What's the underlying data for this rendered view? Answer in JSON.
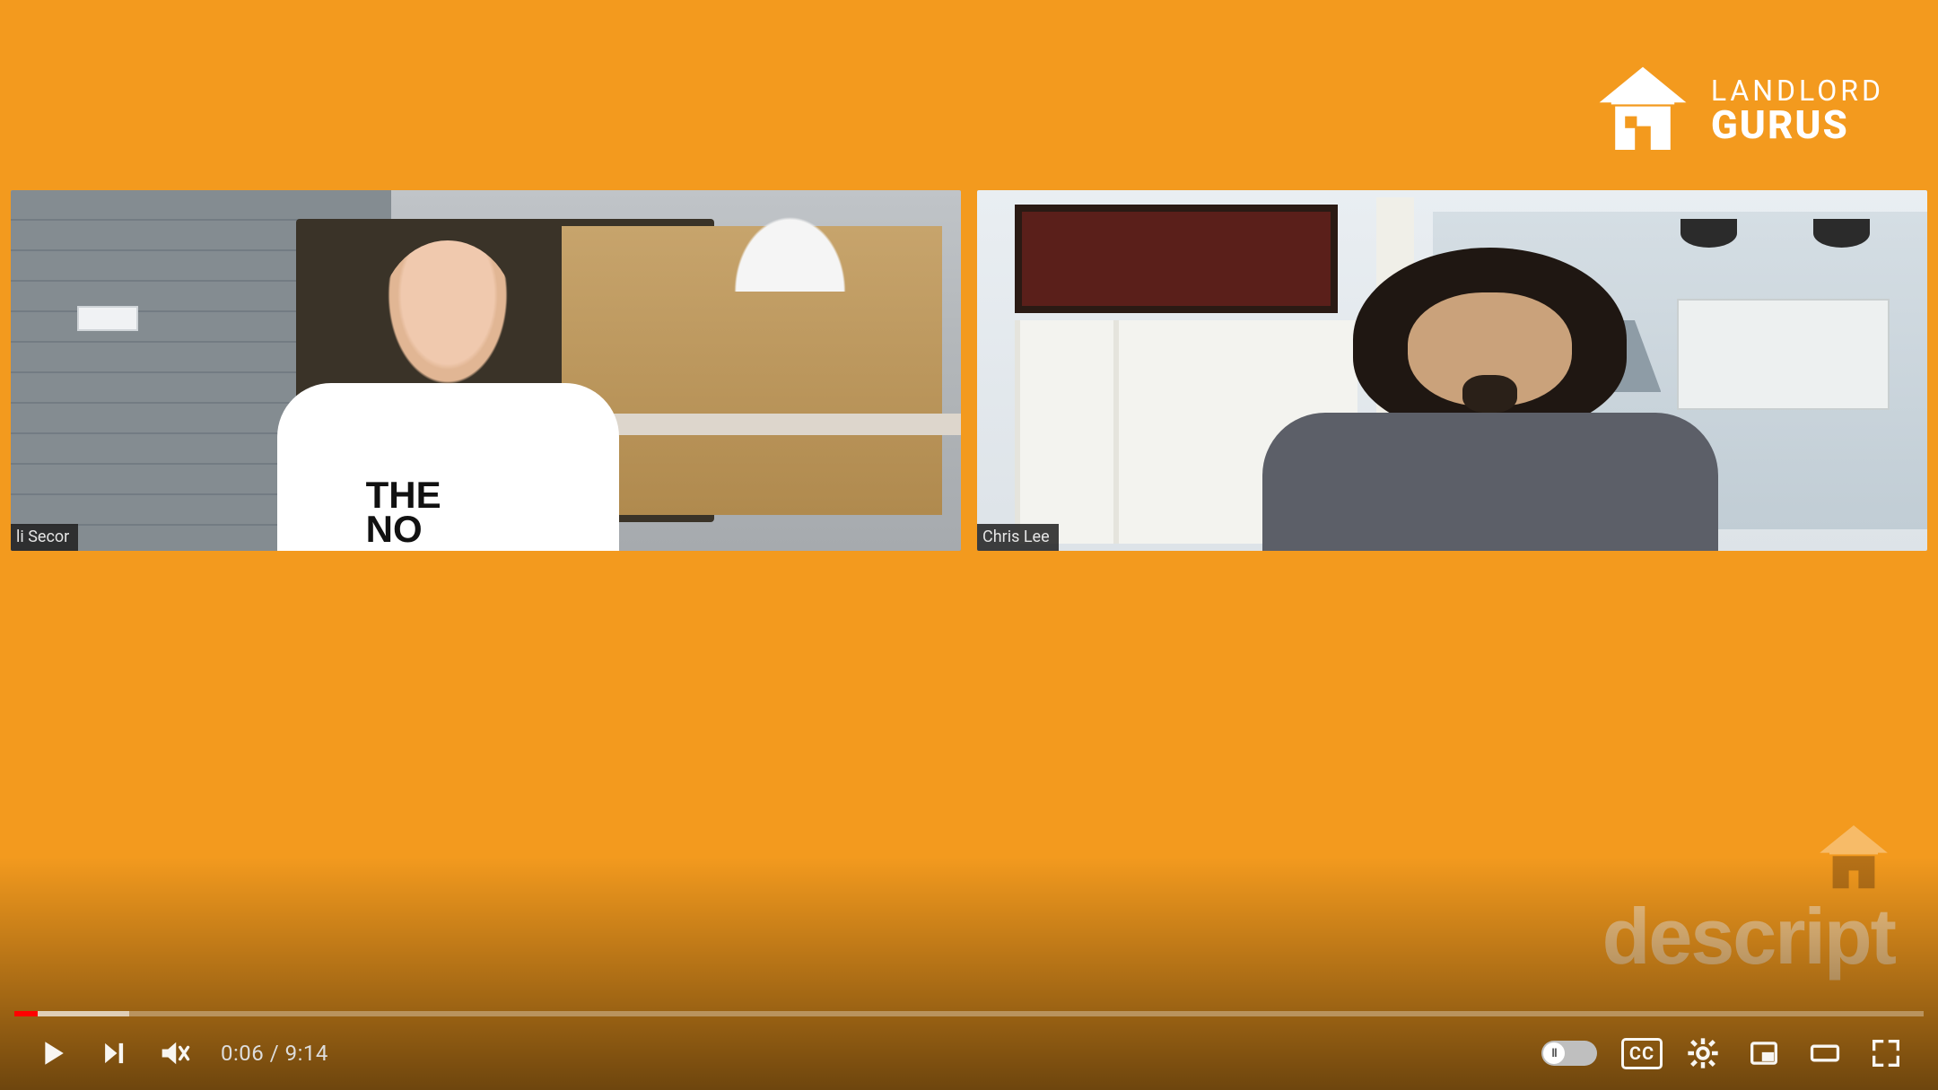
{
  "brand": {
    "line1": "LANDLORD",
    "line2": "GURUS"
  },
  "participants": [
    {
      "name": "li Secor"
    },
    {
      "name": "Chris Lee"
    }
  ],
  "shirt_text_line1": "THE",
  "shirt_text_line2": "NO",
  "watermark_text": "descript",
  "player": {
    "elapsed": "0:06",
    "separator": " / ",
    "duration": "9:14",
    "cc_label": "CC",
    "autoplay_glyph": "II",
    "progress_played_pct": 1.2,
    "progress_loaded_pct": 6,
    "colors": {
      "played": "#ff0000",
      "brand_bg": "#f39a1e"
    }
  }
}
